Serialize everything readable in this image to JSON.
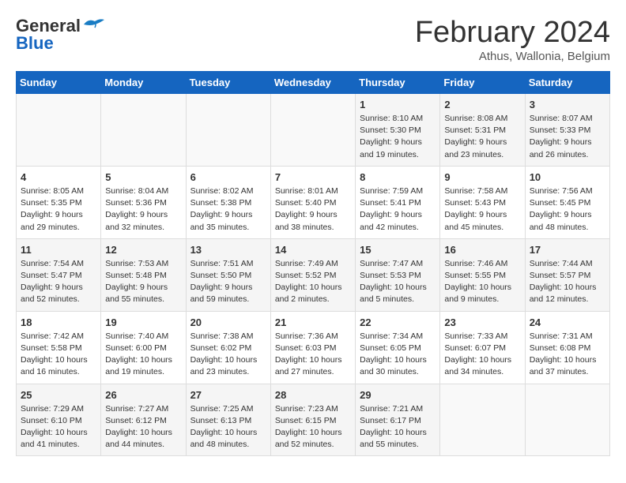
{
  "logo": {
    "line1": "General",
    "line2": "Blue"
  },
  "title": "February 2024",
  "subtitle": "Athus, Wallonia, Belgium",
  "days_of_week": [
    "Sunday",
    "Monday",
    "Tuesday",
    "Wednesday",
    "Thursday",
    "Friday",
    "Saturday"
  ],
  "weeks": [
    [
      {
        "day": "",
        "info": ""
      },
      {
        "day": "",
        "info": ""
      },
      {
        "day": "",
        "info": ""
      },
      {
        "day": "",
        "info": ""
      },
      {
        "day": "1",
        "info": "Sunrise: 8:10 AM\nSunset: 5:30 PM\nDaylight: 9 hours\nand 19 minutes."
      },
      {
        "day": "2",
        "info": "Sunrise: 8:08 AM\nSunset: 5:31 PM\nDaylight: 9 hours\nand 23 minutes."
      },
      {
        "day": "3",
        "info": "Sunrise: 8:07 AM\nSunset: 5:33 PM\nDaylight: 9 hours\nand 26 minutes."
      }
    ],
    [
      {
        "day": "4",
        "info": "Sunrise: 8:05 AM\nSunset: 5:35 PM\nDaylight: 9 hours\nand 29 minutes."
      },
      {
        "day": "5",
        "info": "Sunrise: 8:04 AM\nSunset: 5:36 PM\nDaylight: 9 hours\nand 32 minutes."
      },
      {
        "day": "6",
        "info": "Sunrise: 8:02 AM\nSunset: 5:38 PM\nDaylight: 9 hours\nand 35 minutes."
      },
      {
        "day": "7",
        "info": "Sunrise: 8:01 AM\nSunset: 5:40 PM\nDaylight: 9 hours\nand 38 minutes."
      },
      {
        "day": "8",
        "info": "Sunrise: 7:59 AM\nSunset: 5:41 PM\nDaylight: 9 hours\nand 42 minutes."
      },
      {
        "day": "9",
        "info": "Sunrise: 7:58 AM\nSunset: 5:43 PM\nDaylight: 9 hours\nand 45 minutes."
      },
      {
        "day": "10",
        "info": "Sunrise: 7:56 AM\nSunset: 5:45 PM\nDaylight: 9 hours\nand 48 minutes."
      }
    ],
    [
      {
        "day": "11",
        "info": "Sunrise: 7:54 AM\nSunset: 5:47 PM\nDaylight: 9 hours\nand 52 minutes."
      },
      {
        "day": "12",
        "info": "Sunrise: 7:53 AM\nSunset: 5:48 PM\nDaylight: 9 hours\nand 55 minutes."
      },
      {
        "day": "13",
        "info": "Sunrise: 7:51 AM\nSunset: 5:50 PM\nDaylight: 9 hours\nand 59 minutes."
      },
      {
        "day": "14",
        "info": "Sunrise: 7:49 AM\nSunset: 5:52 PM\nDaylight: 10 hours\nand 2 minutes."
      },
      {
        "day": "15",
        "info": "Sunrise: 7:47 AM\nSunset: 5:53 PM\nDaylight: 10 hours\nand 5 minutes."
      },
      {
        "day": "16",
        "info": "Sunrise: 7:46 AM\nSunset: 5:55 PM\nDaylight: 10 hours\nand 9 minutes."
      },
      {
        "day": "17",
        "info": "Sunrise: 7:44 AM\nSunset: 5:57 PM\nDaylight: 10 hours\nand 12 minutes."
      }
    ],
    [
      {
        "day": "18",
        "info": "Sunrise: 7:42 AM\nSunset: 5:58 PM\nDaylight: 10 hours\nand 16 minutes."
      },
      {
        "day": "19",
        "info": "Sunrise: 7:40 AM\nSunset: 6:00 PM\nDaylight: 10 hours\nand 19 minutes."
      },
      {
        "day": "20",
        "info": "Sunrise: 7:38 AM\nSunset: 6:02 PM\nDaylight: 10 hours\nand 23 minutes."
      },
      {
        "day": "21",
        "info": "Sunrise: 7:36 AM\nSunset: 6:03 PM\nDaylight: 10 hours\nand 27 minutes."
      },
      {
        "day": "22",
        "info": "Sunrise: 7:34 AM\nSunset: 6:05 PM\nDaylight: 10 hours\nand 30 minutes."
      },
      {
        "day": "23",
        "info": "Sunrise: 7:33 AM\nSunset: 6:07 PM\nDaylight: 10 hours\nand 34 minutes."
      },
      {
        "day": "24",
        "info": "Sunrise: 7:31 AM\nSunset: 6:08 PM\nDaylight: 10 hours\nand 37 minutes."
      }
    ],
    [
      {
        "day": "25",
        "info": "Sunrise: 7:29 AM\nSunset: 6:10 PM\nDaylight: 10 hours\nand 41 minutes."
      },
      {
        "day": "26",
        "info": "Sunrise: 7:27 AM\nSunset: 6:12 PM\nDaylight: 10 hours\nand 44 minutes."
      },
      {
        "day": "27",
        "info": "Sunrise: 7:25 AM\nSunset: 6:13 PM\nDaylight: 10 hours\nand 48 minutes."
      },
      {
        "day": "28",
        "info": "Sunrise: 7:23 AM\nSunset: 6:15 PM\nDaylight: 10 hours\nand 52 minutes."
      },
      {
        "day": "29",
        "info": "Sunrise: 7:21 AM\nSunset: 6:17 PM\nDaylight: 10 hours\nand 55 minutes."
      },
      {
        "day": "",
        "info": ""
      },
      {
        "day": "",
        "info": ""
      }
    ]
  ]
}
